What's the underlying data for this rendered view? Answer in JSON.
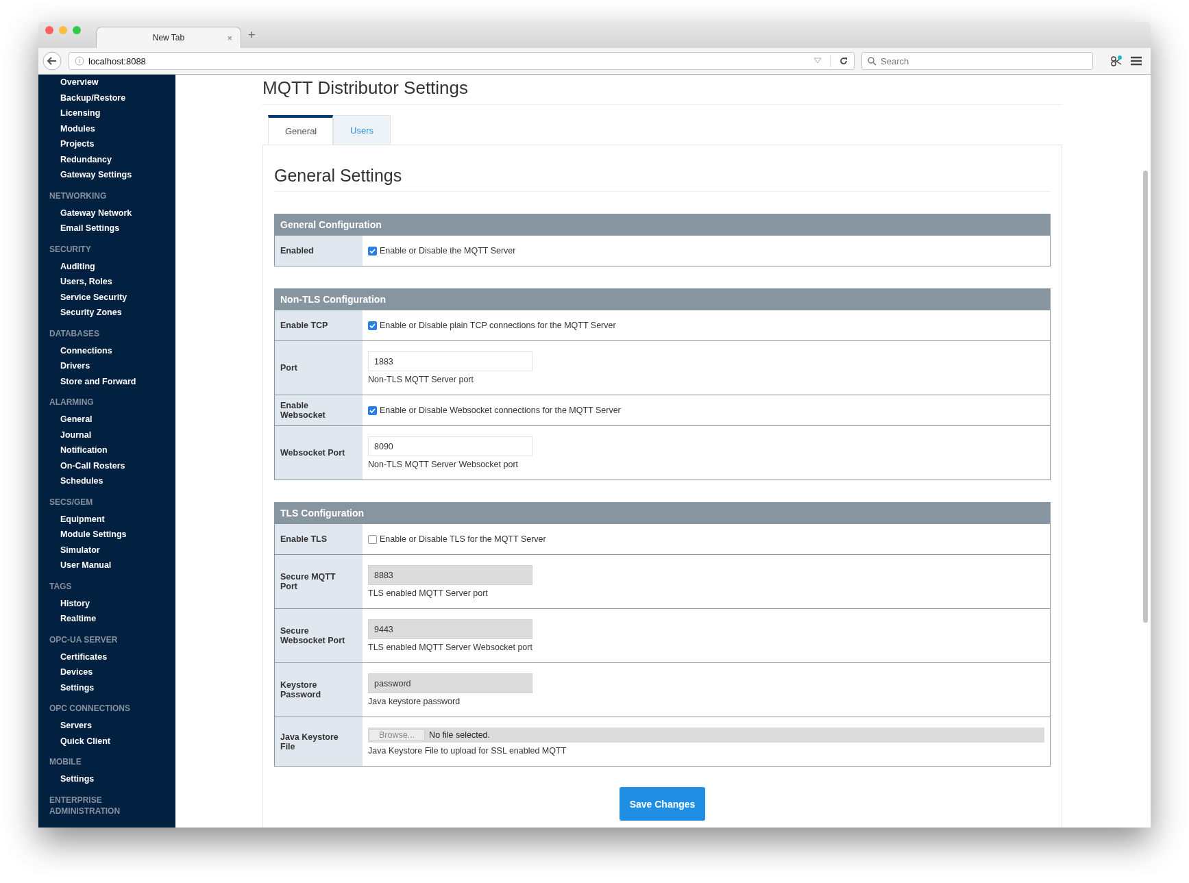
{
  "browser": {
    "tab_title": "New Tab",
    "tab_close": "×",
    "new_tab": "+",
    "url": "localhost:8088",
    "search_placeholder": "Search"
  },
  "sidebar": [
    {
      "items": [
        "Overview",
        "Backup/Restore",
        "Licensing",
        "Modules",
        "Projects",
        "Redundancy",
        "Gateway Settings"
      ]
    },
    {
      "heading": "NETWORKING",
      "items": [
        "Gateway Network",
        "Email Settings"
      ]
    },
    {
      "heading": "SECURITY",
      "items": [
        "Auditing",
        "Users, Roles",
        "Service Security",
        "Security Zones"
      ]
    },
    {
      "heading": "DATABASES",
      "items": [
        "Connections",
        "Drivers",
        "Store and Forward"
      ]
    },
    {
      "heading": "ALARMING",
      "items": [
        "General",
        "Journal",
        "Notification",
        "On-Call Rosters",
        "Schedules"
      ]
    },
    {
      "heading": "SECS/GEM",
      "items": [
        "Equipment",
        "Module Settings",
        "Simulator",
        "User Manual"
      ]
    },
    {
      "heading": "TAGS",
      "items": [
        "History",
        "Realtime"
      ]
    },
    {
      "heading": "OPC-UA SERVER",
      "items": [
        "Certificates",
        "Devices",
        "Settings"
      ]
    },
    {
      "heading": "OPC CONNECTIONS",
      "items": [
        "Servers",
        "Quick Client"
      ]
    },
    {
      "heading": "MOBILE",
      "items": [
        "Settings"
      ]
    },
    {
      "heading": "ENTERPRISE ADMINISTRATION"
    }
  ],
  "page_title": "MQTT Distributor Settings",
  "tabs": [
    {
      "label": "General",
      "selected": true
    },
    {
      "label": "Users",
      "selected": false
    }
  ],
  "section_title": "General Settings",
  "sections": [
    {
      "title": "General Configuration",
      "rows": [
        {
          "label": "Enabled",
          "kind": "checkbox",
          "checked": true,
          "text": "Enable or Disable the MQTT Server"
        }
      ]
    },
    {
      "title": "Non-TLS Configuration",
      "rows": [
        {
          "label": "Enable TCP",
          "kind": "checkbox",
          "checked": true,
          "text": "Enable or Disable plain TCP connections for the MQTT Server"
        },
        {
          "label": "Port",
          "kind": "input",
          "disabled": false,
          "value": "1883",
          "hint": "Non-TLS MQTT Server port"
        },
        {
          "label": "Enable Websocket",
          "kind": "checkbox",
          "checked": true,
          "text": "Enable or Disable Websocket connections for the MQTT Server"
        },
        {
          "label": "Websocket Port",
          "kind": "input",
          "disabled": false,
          "value": "8090",
          "hint": "Non-TLS MQTT Server Websocket port"
        }
      ]
    },
    {
      "title": "TLS Configuration",
      "rows": [
        {
          "label": "Enable TLS",
          "kind": "checkbox",
          "checked": false,
          "text": "Enable or Disable TLS for the MQTT Server"
        },
        {
          "label": "Secure MQTT Port",
          "kind": "input",
          "disabled": true,
          "value": "8883",
          "hint": "TLS enabled MQTT Server port"
        },
        {
          "label": "Secure Websocket Port",
          "kind": "input",
          "disabled": true,
          "value": "9443",
          "hint": "TLS enabled MQTT Server Websocket port"
        },
        {
          "label": "Keystore Password",
          "kind": "input",
          "disabled": true,
          "value": "password",
          "hint": "Java keystore password"
        },
        {
          "label": "Java Keystore File",
          "kind": "file",
          "disabled": true,
          "button": "Browse...",
          "value": "No file selected.",
          "hint": "Java Keystore File to upload for SSL enabled MQTT"
        }
      ]
    }
  ],
  "save_button": "Save Changes"
}
